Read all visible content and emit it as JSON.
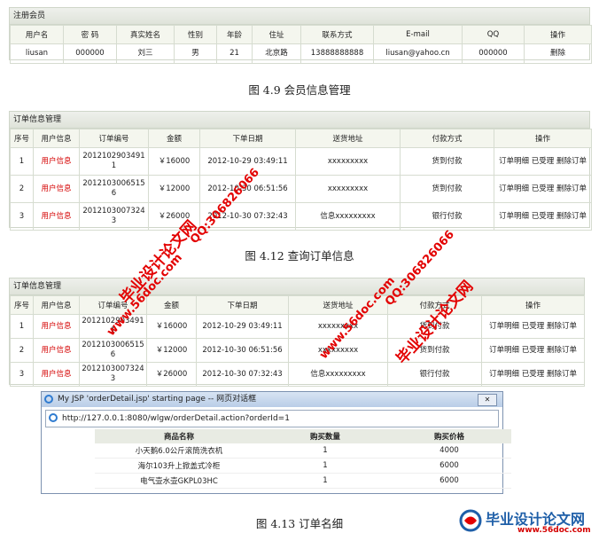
{
  "member": {
    "title": "注册会员",
    "headers": [
      "用户名",
      "密 码",
      "真实姓名",
      "性别",
      "年龄",
      "住址",
      "联系方式",
      "E-mail",
      "QQ",
      "操作"
    ],
    "rows": [
      [
        "liusan",
        "000000",
        "刘三",
        "男",
        "21",
        "北京路",
        "13888888888",
        "liusan@yahoo.cn",
        "000000",
        "删除"
      ]
    ]
  },
  "caption_1": "图 4.9 会员信息管理",
  "orders_1": {
    "title": "订单信息管理",
    "headers": [
      "序号",
      "用户信息",
      "订单编号",
      "金额",
      "下单日期",
      "送货地址",
      "付款方式",
      "操作"
    ],
    "rows": [
      [
        "1",
        "用户信息",
        "20121029034911",
        "￥16000",
        "2012-10-29 03:49:11",
        "xxxxxxxxx",
        "货到付款",
        "订单明细 已受理 删除订单"
      ],
      [
        "2",
        "用户信息",
        "20121030065156",
        "￥12000",
        "2012-10-30 06:51:56",
        "xxxxxxxxx",
        "货到付款",
        "订单明细 已受理 删除订单"
      ],
      [
        "3",
        "用户信息",
        "20121030073243",
        "￥26000",
        "2012-10-30 07:32:43",
        "信息xxxxxxxxx",
        "银行付款",
        "订单明细 已受理 删除订单"
      ]
    ]
  },
  "caption_2": "图 4.12 查询订单信息",
  "orders_2": {
    "title": "订单信息管理",
    "headers": [
      "序号",
      "用户信息",
      "订单编号",
      "金额",
      "下单日期",
      "送货地址",
      "付款方式",
      "操作"
    ],
    "rows": [
      [
        "1",
        "用户信息",
        "20121029034911",
        "￥16000",
        "2012-10-29 03:49:11",
        "xxxxxxxxx",
        "货到付款",
        "订单明细 已受理 删除订单"
      ],
      [
        "2",
        "用户信息",
        "20121030065156",
        "￥12000",
        "2012-10-30 06:51:56",
        "xxxxxxxxx",
        "货到付款",
        "订单明细 已受理 删除订单"
      ],
      [
        "3",
        "用户信息",
        "20121030073243",
        "￥26000",
        "2012-10-30 07:32:43",
        "信息xxxxxxxxx",
        "银行付款",
        "订单明细 已受理 删除订单"
      ]
    ]
  },
  "dialog": {
    "title": "My JSP 'orderDetail.jsp' starting page -- 网页对话框",
    "close_label": "✕",
    "url": "http://127.0.0.1:8080/wlgw/orderDetail.action?orderId=1",
    "headers": [
      "商品名称",
      "购买数量",
      "购买价格"
    ],
    "rows": [
      [
        "小天鹅6.0公斤滚筒洗衣机",
        "1",
        "4000"
      ],
      [
        "海尔103升上掀盖式冷柜",
        "1",
        "6000"
      ],
      [
        "电气壶水壶GKPL03HC",
        "1",
        "6000"
      ]
    ]
  },
  "caption_3": "图 4.13 订单名细",
  "watermarks": {
    "text_cn": "毕业设计论文网",
    "text_url": "www.56doc.com",
    "text_qq": "QQ:306826066"
  },
  "logo": {
    "name": "毕业设计论文网",
    "url": "www.56doc.com"
  },
  "colors": {
    "red": "#d40000",
    "watermark": "#e30000",
    "header_bg": "#f4f6ee",
    "logo_blue": "#1f5fa8"
  }
}
